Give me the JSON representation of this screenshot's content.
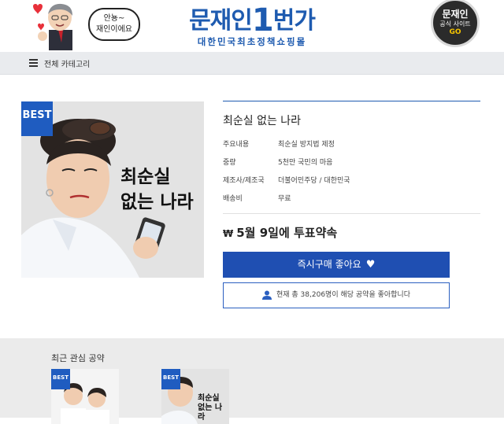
{
  "header": {
    "bubble_line1": "안뇽~",
    "bubble_line2": "재인이에요",
    "logo_part1": "문재인",
    "logo_number": "1",
    "logo_part2": "번가",
    "logo_sub": "대한민국최초정책쇼핑몰",
    "go_badge": {
      "line1": "문재인",
      "line2": "공식 사이트",
      "line3": "GO"
    }
  },
  "category_bar": {
    "label": "전체 카테고리"
  },
  "product": {
    "badge": "BEST",
    "image_text_line1": "최순실",
    "image_text_line2": "없는 나라",
    "title": "최순실 없는 나라",
    "specs": [
      {
        "key": "주요내용",
        "value": "최순실 방지법 제정"
      },
      {
        "key": "중량",
        "value": "5천만 국민의 마음"
      },
      {
        "key": "제조사/제조국",
        "value": "더불어민주당 / 대한민국"
      },
      {
        "key": "배송비",
        "value": "무료"
      }
    ],
    "price_symbol": "₩",
    "price_text": "5월 9일에 투표약속",
    "buy_button": "즉시구매 좋아요",
    "like_text": "현재 총 38,206명이 해당 공약을 좋아합니다"
  },
  "recent": {
    "title": "최근 관심 공약",
    "items": [
      {
        "badge": "BEST",
        "text_line1": "",
        "text_line2": ""
      },
      {
        "badge": "BEST",
        "text_line1": "최순실",
        "text_line2": "없는 나라"
      }
    ]
  },
  "colors": {
    "accent": "#1f4fb2",
    "badge": "#1f5cc0",
    "logo": "#1e5bb0"
  }
}
